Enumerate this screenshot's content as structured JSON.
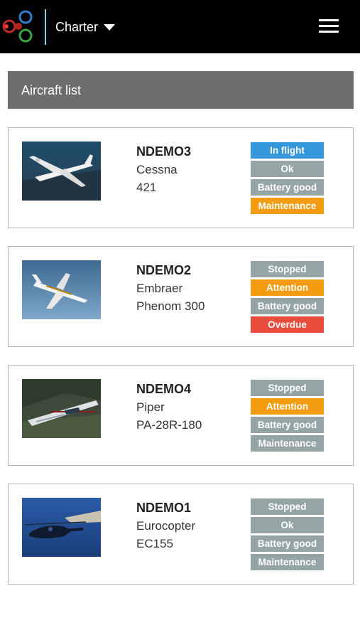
{
  "header": {
    "account_label": "Charter",
    "logo_icon": "tri-circle-logo",
    "menu_icon": "hamburger-icon"
  },
  "list": {
    "title": "Aircraft list"
  },
  "colors": {
    "in_flight": "#3498db",
    "neutral": "#95a5a6",
    "warning": "#f39c12",
    "danger": "#e74c3c"
  },
  "aircraft": [
    {
      "registration": "NDEMO3",
      "make": "Cessna",
      "model": "421",
      "statuses": [
        {
          "label": "In flight",
          "color": "#3498db"
        },
        {
          "label": "Ok",
          "color": "#95a5a6"
        },
        {
          "label": "Battery good",
          "color": "#95a5a6"
        },
        {
          "label": "Maintenance",
          "color": "#f39c12"
        }
      ]
    },
    {
      "registration": "NDEMO2",
      "make": "Embraer",
      "model": "Phenom 300",
      "statuses": [
        {
          "label": "Stopped",
          "color": "#95a5a6"
        },
        {
          "label": "Attention",
          "color": "#f39c12"
        },
        {
          "label": "Battery good",
          "color": "#95a5a6"
        },
        {
          "label": "Overdue",
          "color": "#e74c3c"
        }
      ]
    },
    {
      "registration": "NDEMO4",
      "make": "Piper",
      "model": "PA-28R-180",
      "statuses": [
        {
          "label": "Stopped",
          "color": "#95a5a6"
        },
        {
          "label": "Attention",
          "color": "#f39c12"
        },
        {
          "label": "Battery good",
          "color": "#95a5a6"
        },
        {
          "label": "Maintenance",
          "color": "#95a5a6"
        }
      ]
    },
    {
      "registration": "NDEMO1",
      "make": "Eurocopter",
      "model": "EC155",
      "statuses": [
        {
          "label": "Stopped",
          "color": "#95a5a6"
        },
        {
          "label": "Ok",
          "color": "#95a5a6"
        },
        {
          "label": "Battery good",
          "color": "#95a5a6"
        },
        {
          "label": "Maintenance",
          "color": "#95a5a6"
        }
      ]
    }
  ]
}
